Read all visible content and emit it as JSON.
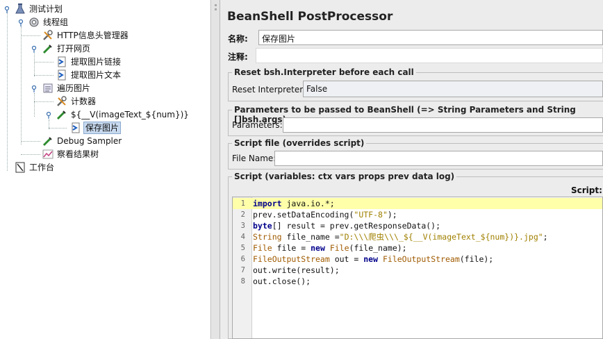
{
  "tree": {
    "nodes": [
      {
        "label": "测试计划",
        "icon": "flask-icon"
      },
      {
        "label": "线程组",
        "icon": "gear-icon"
      },
      {
        "label": "HTTP信息头管理器",
        "icon": "wrench-icon"
      },
      {
        "label": "打开网页",
        "icon": "pipette-icon"
      },
      {
        "label": "提取图片链接",
        "icon": "arrow-doc-icon"
      },
      {
        "label": "提取图片文本",
        "icon": "arrow-doc-icon"
      },
      {
        "label": "遍历图片",
        "icon": "loop-icon"
      },
      {
        "label": "计数器",
        "icon": "wrench-icon"
      },
      {
        "label": "${__V(imageText_${num})}",
        "icon": "pipette-icon"
      },
      {
        "label": "保存图片",
        "icon": "arrow-doc-icon"
      },
      {
        "label": "Debug Sampler",
        "icon": "pipette-icon"
      },
      {
        "label": "察看结果树",
        "icon": "chart-icon"
      },
      {
        "label": "工作台",
        "icon": "workbench-icon"
      }
    ],
    "selected": "保存图片"
  },
  "panel": {
    "title": "BeanShell PostProcessor",
    "name_label": "名称:",
    "name_value": "保存图片",
    "comment_label": "注释:",
    "comment_value": "",
    "reset_group": "Reset bsh.Interpreter before each call",
    "reset_label": "Reset Interpreter:",
    "reset_value": "False",
    "params_group": "Parameters to be passed to BeanShell (=> String Parameters and String []bsh.args)",
    "params_label": "Parameters:",
    "params_value": "",
    "file_group": "Script file (overrides script)",
    "file_label": "File Name:",
    "file_value": "",
    "script_group": "Script (variables: ctx vars props prev data log)",
    "script_label": "Script:"
  },
  "script": {
    "line_numbers": [
      "1",
      "2",
      "3",
      "4",
      "5",
      "6",
      "7",
      "8"
    ],
    "lines": [
      [
        {
          "t": "kw",
          "s": "import"
        },
        {
          "t": "pl",
          "s": " java.io.*;"
        }
      ],
      [
        {
          "t": "pl",
          "s": "prev.setDataEncoding("
        },
        {
          "t": "str",
          "s": "\"UTF-8\""
        },
        {
          "t": "pl",
          "s": ");"
        }
      ],
      [
        {
          "t": "kw",
          "s": "byte"
        },
        {
          "t": "pl",
          "s": "[] result = prev.getResponseData();"
        }
      ],
      [
        {
          "t": "typ",
          "s": "String"
        },
        {
          "t": "pl",
          "s": " file_name ="
        },
        {
          "t": "str",
          "s": "\"D:\\\\\\爬虫\\\\\\_${__V(imageText_${num})}.jpg\""
        },
        {
          "t": "pl",
          "s": ";"
        }
      ],
      [
        {
          "t": "typ",
          "s": "File"
        },
        {
          "t": "pl",
          "s": " file = "
        },
        {
          "t": "kw",
          "s": "new"
        },
        {
          "t": "pl",
          "s": " "
        },
        {
          "t": "typ",
          "s": "File"
        },
        {
          "t": "pl",
          "s": "(file_name);"
        }
      ],
      [
        {
          "t": "typ",
          "s": "FileOutputStream"
        },
        {
          "t": "pl",
          "s": " out = "
        },
        {
          "t": "kw",
          "s": "new"
        },
        {
          "t": "pl",
          "s": " "
        },
        {
          "t": "typ",
          "s": "FileOutputStream"
        },
        {
          "t": "pl",
          "s": "(file);"
        }
      ],
      [
        {
          "t": "pl",
          "s": "out.write(result);"
        }
      ],
      [
        {
          "t": "pl",
          "s": "out.close();"
        }
      ]
    ]
  }
}
